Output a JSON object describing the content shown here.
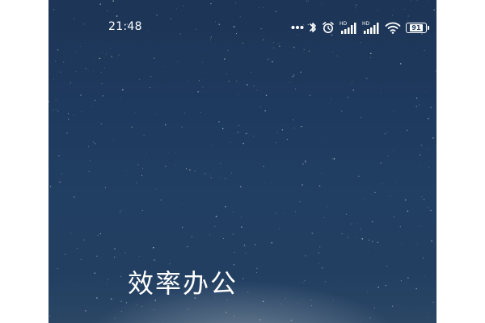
{
  "status_bar": {
    "time": "21:48",
    "icons": [
      "more-dots-icon",
      "bluetooth-icon",
      "alarm-icon",
      "signal-hd-icon",
      "signal-hd-icon",
      "wifi-icon",
      "battery-icon"
    ],
    "hd_label_1": "HD",
    "hd_label_2": "HD",
    "battery_level": "91"
  },
  "wallpaper": {
    "theme": "night-sky",
    "colors": {
      "top": "#1d3556",
      "middle": "#213f63",
      "bottom_glow": "#b4bec8"
    }
  },
  "headline": {
    "text": "效率办公"
  }
}
